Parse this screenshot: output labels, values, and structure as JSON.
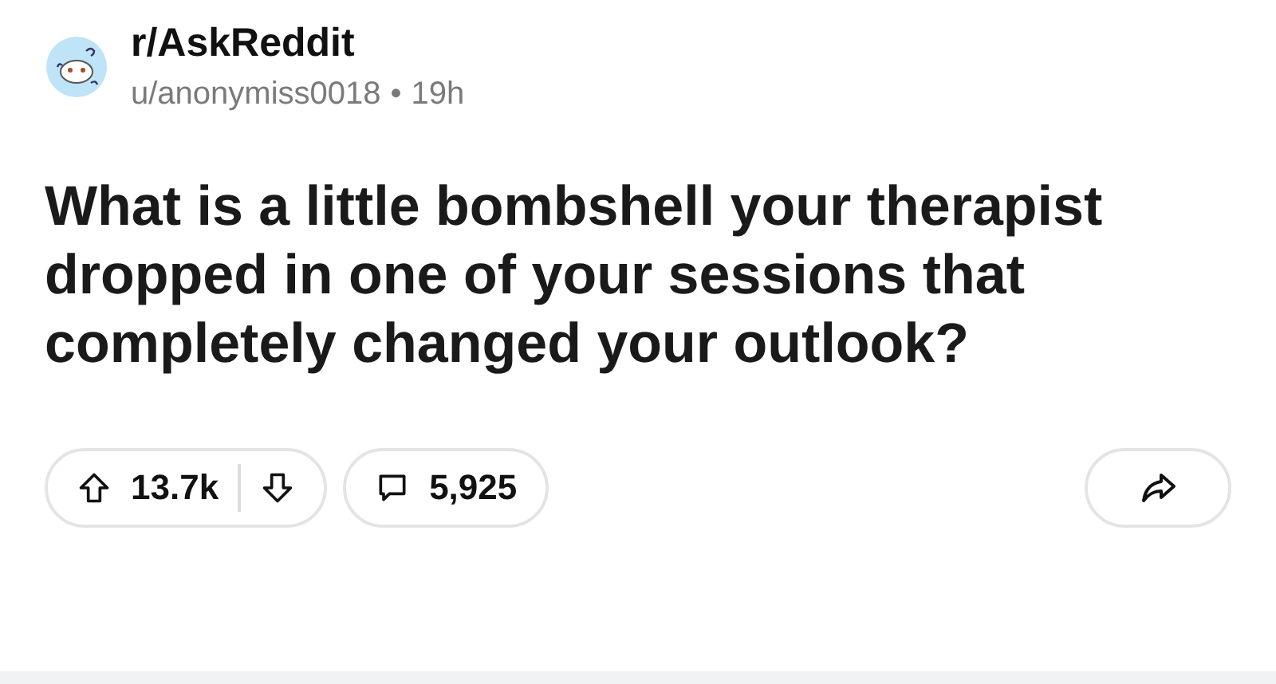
{
  "post": {
    "subreddit": "r/AskReddit",
    "author": "u/anonymiss0018",
    "separator": "•",
    "age": "19h",
    "title": "What is a little bombshell your therapist dropped in one of your sessions that completely changed your outlook?"
  },
  "actions": {
    "score": "13.7k",
    "comments": "5,925"
  }
}
